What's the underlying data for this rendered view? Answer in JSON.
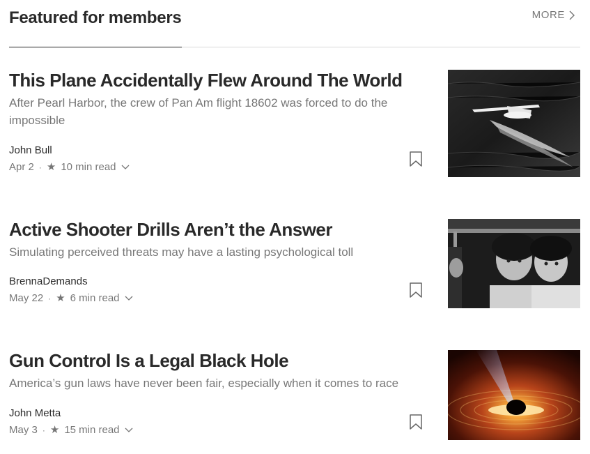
{
  "section": {
    "title": "Featured for members",
    "more_label": "MORE"
  },
  "articles": [
    {
      "title": "This Plane Accidentally Flew Around The World",
      "subtitle": "After Pearl Harbor, the crew of Pan Am flight 18602 was forced to do the impossible",
      "author": "John Bull",
      "date": "Apr 2",
      "read_time": "10 min read",
      "thumbnail_icon": "seaplane-photo"
    },
    {
      "title": "Active Shooter Drills Aren’t the Answer",
      "subtitle": "Simulating perceived threats may have a lasting psychological toll",
      "author": "BrennaDemands",
      "date": "May 22",
      "read_time": "6 min read",
      "thumbnail_icon": "children-under-desk-photo"
    },
    {
      "title": "Gun Control Is a Legal Black Hole",
      "subtitle": "America’s gun laws have never been fair, especially when it comes to race",
      "author": "John Metta",
      "date": "May 3",
      "read_time": "15 min read",
      "thumbnail_icon": "black-hole-illustration"
    }
  ],
  "icons": {
    "member_star": "star-icon",
    "bookmark": "bookmark-icon",
    "more_chevron": "chevron-right-icon",
    "options_chevron": "chevron-down-icon"
  }
}
